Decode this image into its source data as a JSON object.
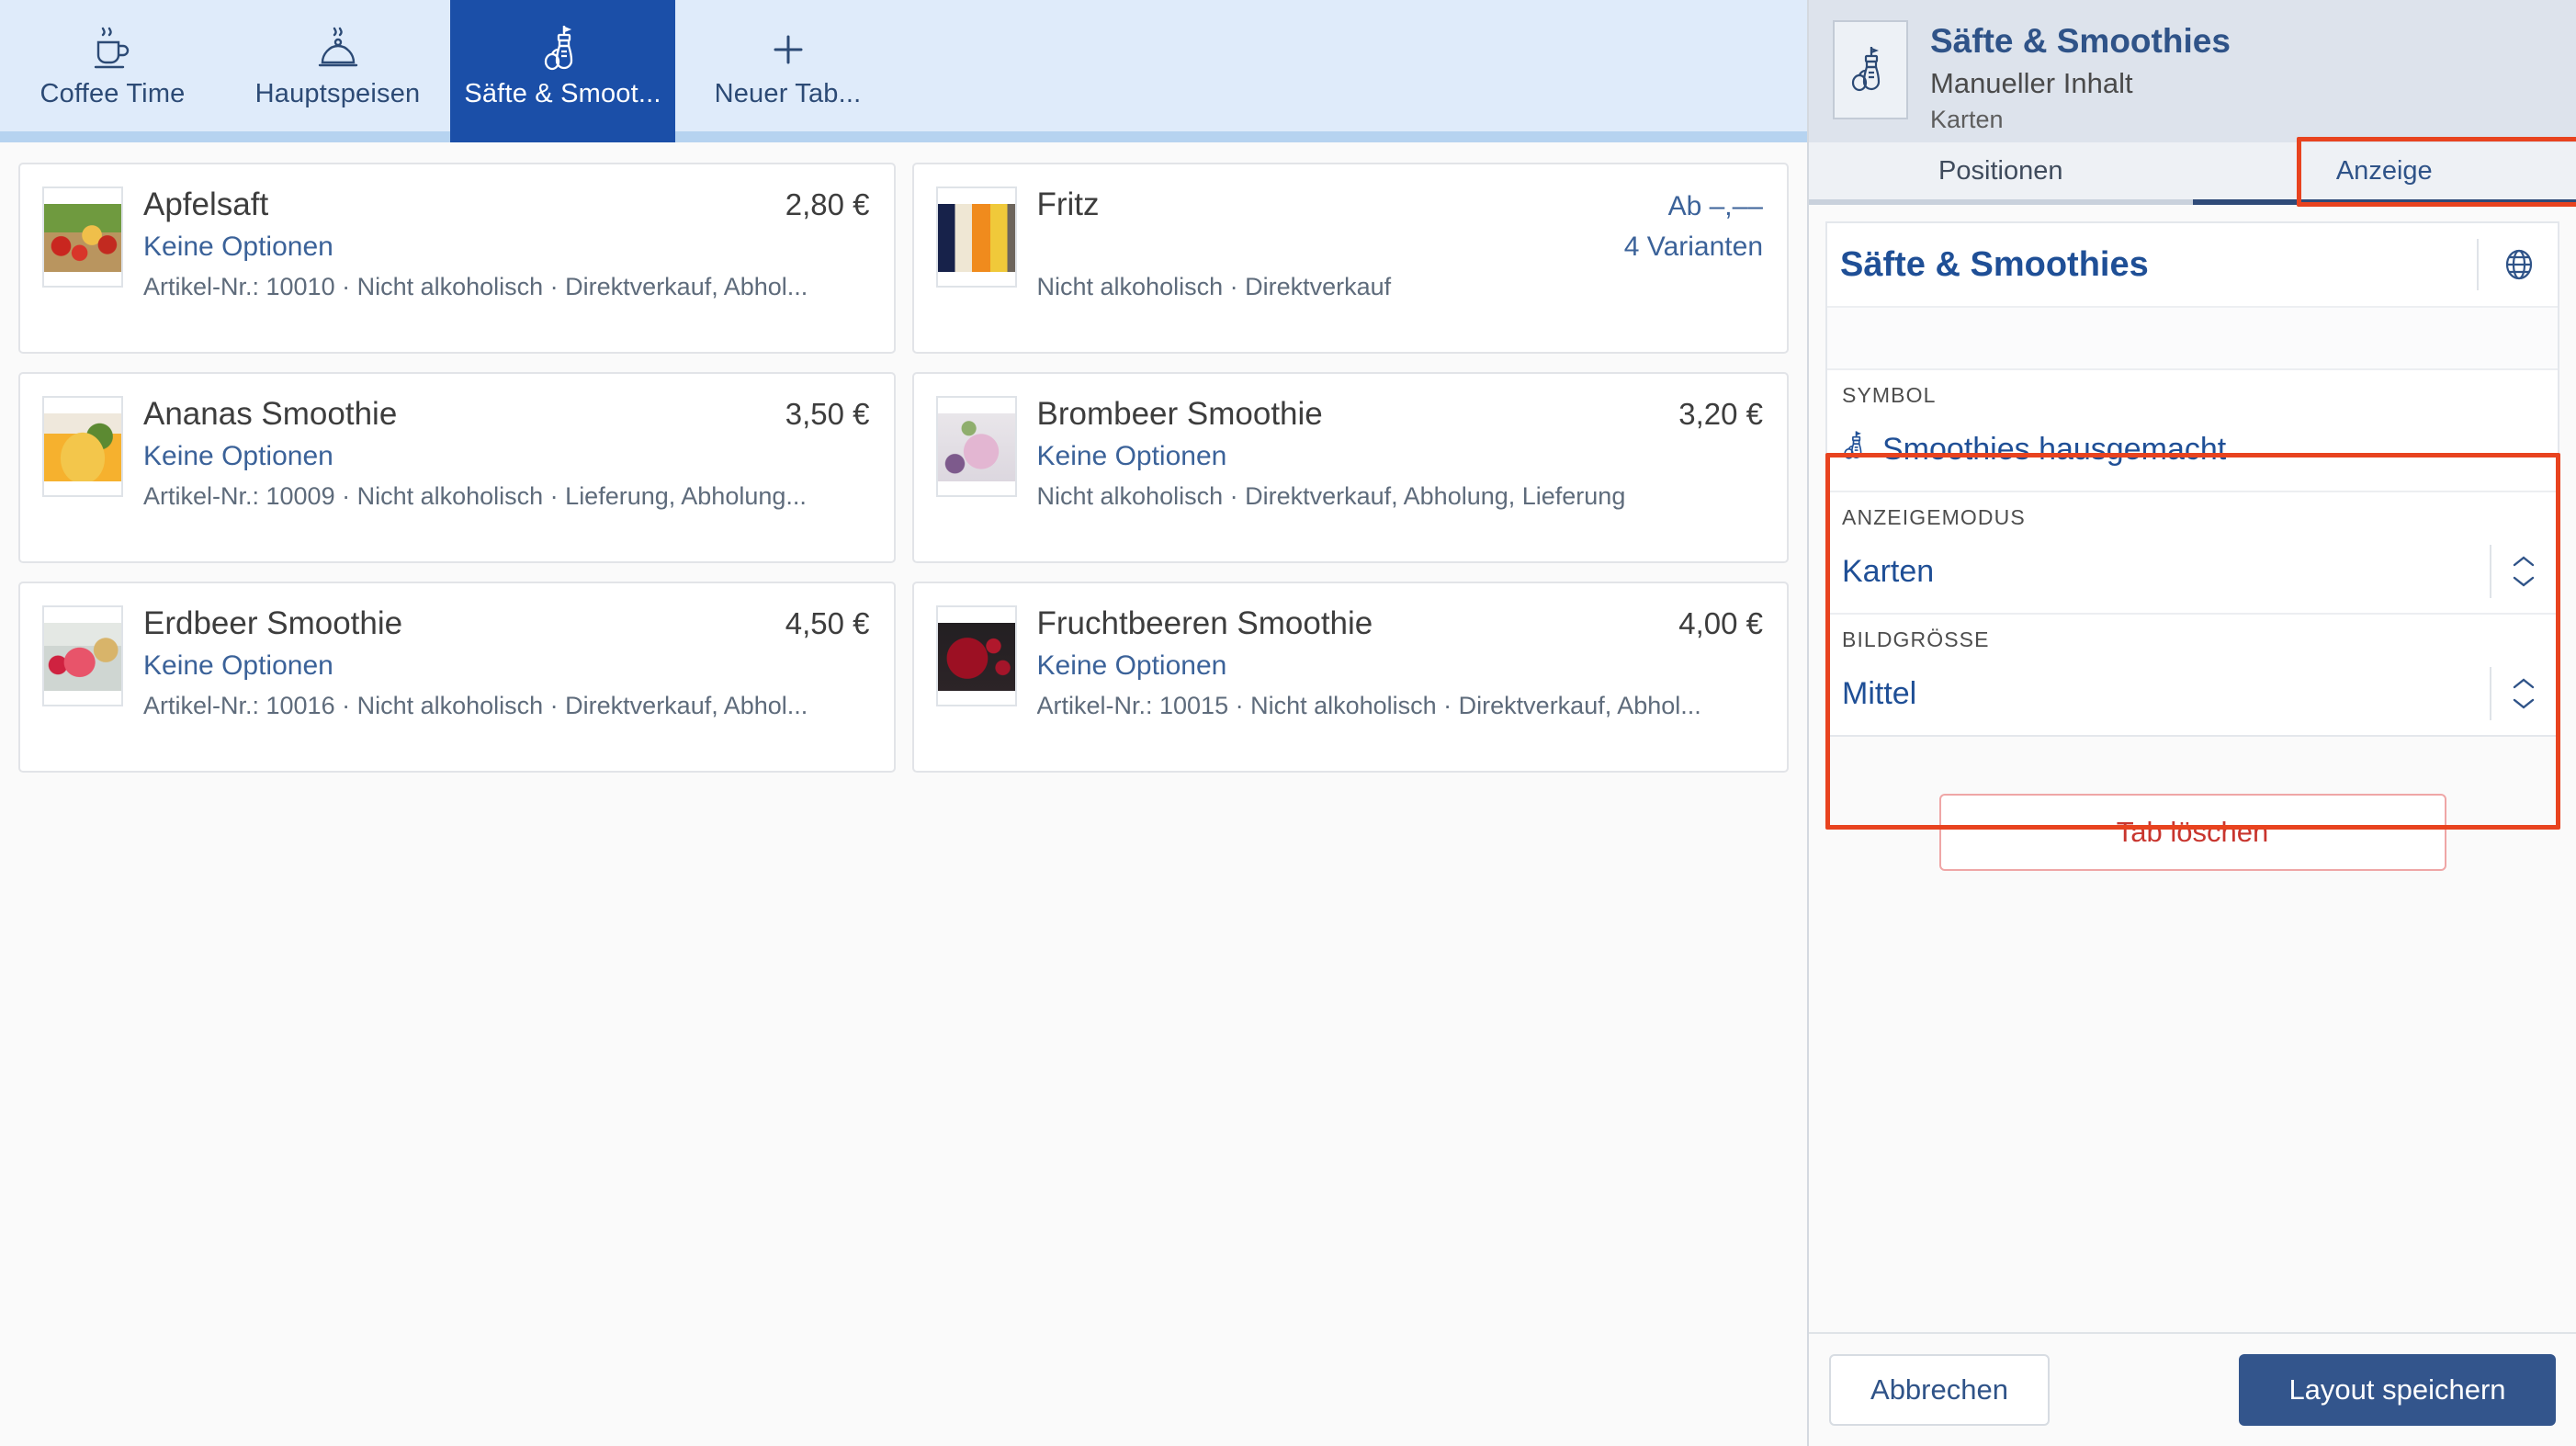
{
  "tabbar": {
    "tabs": [
      {
        "label": "Coffee Time",
        "icon": "coffee-cup-icon",
        "active": false
      },
      {
        "label": "Hauptspeisen",
        "icon": "cloche-icon",
        "active": false
      },
      {
        "label": "Säfte & Smoot...",
        "icon": "smoothie-bottle-icon",
        "active": true
      },
      {
        "label": "Neuer Tab...",
        "icon": "plus-icon",
        "active": false
      }
    ]
  },
  "products": [
    {
      "name": "Apfelsaft",
      "price": "2,80 €",
      "options": "Keine Optionen",
      "meta": "Artikel-Nr.: 10010 · Nicht alkoholisch · Direktverkauf, Abhol...",
      "thumb": "th-apfel",
      "variants": null
    },
    {
      "name": "Fritz",
      "price": "Ab –,––",
      "options": "",
      "meta": "Nicht alkoholisch · Direktverkauf",
      "thumb": "th-fritz",
      "variants": "4 Varianten"
    },
    {
      "name": "Ananas Smoothie",
      "price": "3,50 €",
      "options": "Keine Optionen",
      "meta": "Artikel-Nr.: 10009 · Nicht alkoholisch · Lieferung, Abholung...",
      "thumb": "th-ananas",
      "variants": null
    },
    {
      "name": "Brombeer Smoothie",
      "price": "3,20 €",
      "options": "Keine Optionen",
      "meta": "Nicht alkoholisch · Direktverkauf, Abholung, Lieferung",
      "thumb": "th-brombeer",
      "variants": null
    },
    {
      "name": "Erdbeer Smoothie",
      "price": "4,50 €",
      "options": "Keine Optionen",
      "meta": "Artikel-Nr.: 10016 · Nicht alkoholisch · Direktverkauf, Abhol...",
      "thumb": "th-erdbeer",
      "variants": null
    },
    {
      "name": "Fruchtbeeren Smoothie",
      "price": "4,00 €",
      "options": "Keine Optionen",
      "meta": "Artikel-Nr.: 10015 · Nicht alkoholisch · Direktverkauf, Abhol...",
      "thumb": "th-frucht",
      "variants": null
    }
  ],
  "panel": {
    "header": {
      "title": "Säfte & Smoothies",
      "subtitle": "Manueller Inhalt",
      "subsub": "Karten",
      "icon": "smoothie-bottle-icon"
    },
    "tabs": [
      {
        "label": "Positionen",
        "active": false
      },
      {
        "label": "Anzeige",
        "active": true
      }
    ],
    "form": {
      "name_value": "Säfte & Smoothies",
      "globe_icon": "globe-icon",
      "fields": [
        {
          "label": "SYMBOL",
          "value": "Smoothies hausgemacht",
          "icon": "smoothie-bottle-icon",
          "stepper": false
        },
        {
          "label": "ANZEIGEMODUS",
          "value": "Karten",
          "icon": null,
          "stepper": true
        },
        {
          "label": "BILDGRÖßE",
          "value": "Mittel",
          "icon": null,
          "stepper": true
        }
      ]
    },
    "delete_label": "Tab löschen",
    "footer": {
      "cancel_label": "Abbrechen",
      "save_label": "Layout speichern"
    }
  },
  "colors": {
    "accent_blue": "#1b4fa8",
    "tabbar_bg": "#dfebfa",
    "link_blue": "#3b6299",
    "annotation_red": "#e8431f",
    "danger_red": "#c8352e",
    "save_blue": "#33558c"
  }
}
